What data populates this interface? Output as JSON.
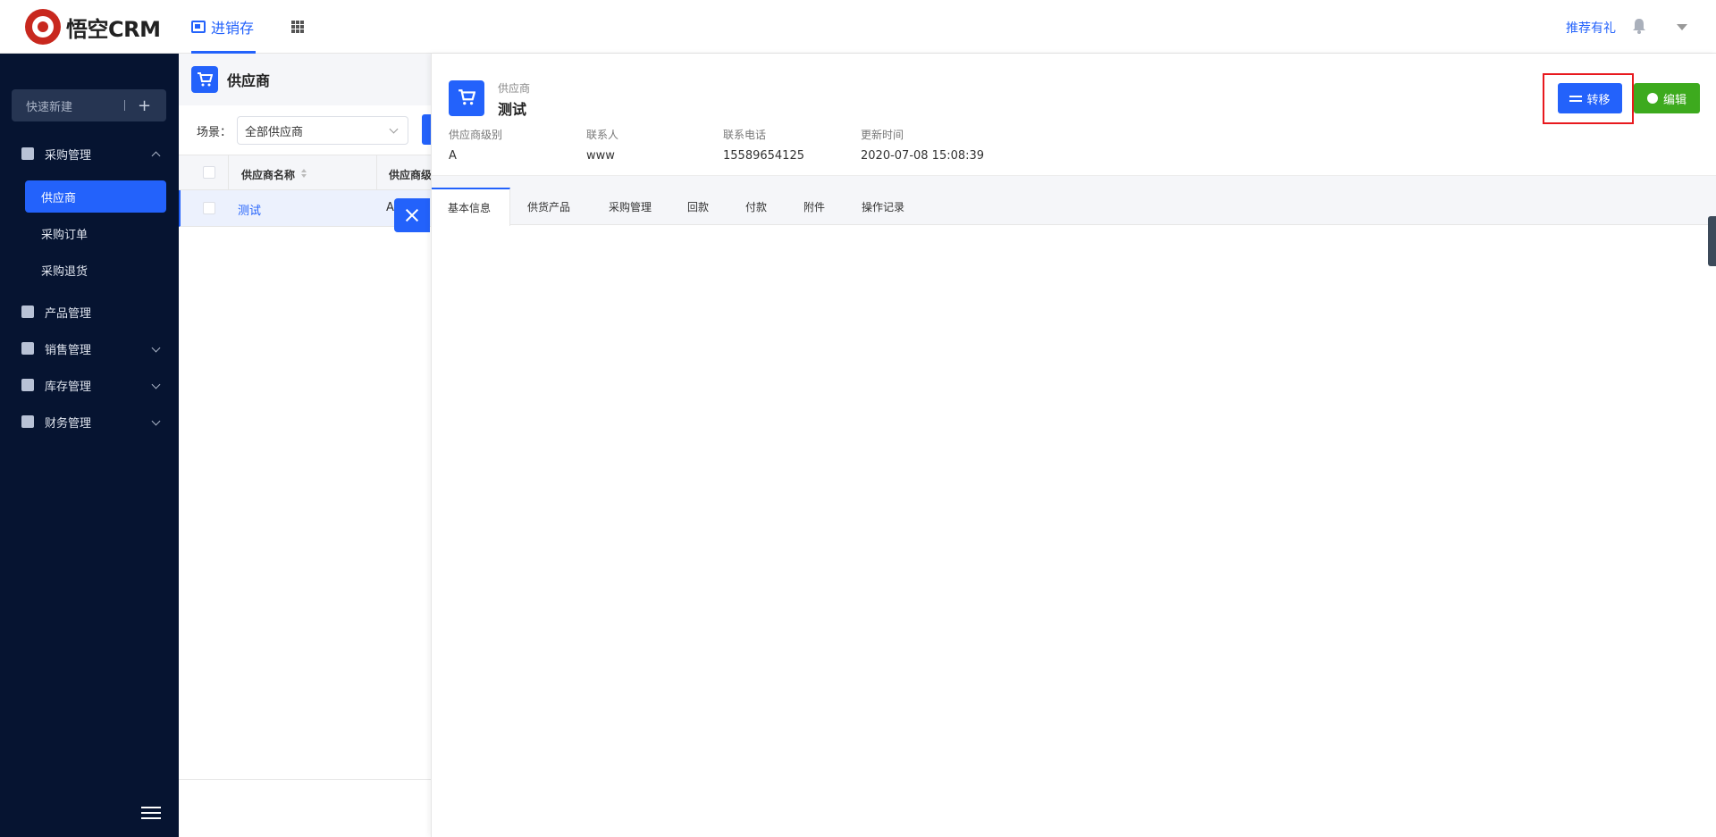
{
  "topbar": {
    "brand": "悟空CRM",
    "nav_tab": "进销存",
    "recommend": "推荐有礼"
  },
  "sidebar": {
    "quick_new": "快速新建",
    "groups": [
      {
        "label": "采购管理",
        "expanded": true
      },
      {
        "label": "产品管理",
        "expanded": false
      },
      {
        "label": "销售管理",
        "expanded": false
      },
      {
        "label": "库存管理",
        "expanded": false
      },
      {
        "label": "财务管理",
        "expanded": false
      }
    ],
    "sub_items": [
      {
        "label": "供应商",
        "active": true
      },
      {
        "label": "采购订单",
        "active": false
      },
      {
        "label": "采购退货",
        "active": false
      }
    ]
  },
  "list": {
    "title": "供应商",
    "scene_label": "场景：",
    "scene_value": "全部供应商",
    "columns": [
      "供应商名称",
      "供应商级别"
    ],
    "rows": [
      {
        "name": "测试",
        "level": "A"
      }
    ]
  },
  "detail": {
    "type": "供应商",
    "name": "测试",
    "fields": [
      {
        "label": "供应商级别",
        "value": "A"
      },
      {
        "label": "联系人",
        "value": "www"
      },
      {
        "label": "联系电话",
        "value": "15589654125"
      },
      {
        "label": "更新时间",
        "value": "2020-07-08 15:08:39"
      }
    ],
    "transfer_label": "转移",
    "edit_label": "编辑",
    "tabs": [
      "基本信息",
      "供货产品",
      "采购管理",
      "回款",
      "付款",
      "附件",
      "操作记录"
    ],
    "active_tab": "基本信息"
  },
  "colors": {
    "primary": "#2362fb",
    "success": "#3daa1e",
    "sidebar_bg": "#061431",
    "highlight": "#e8191e"
  }
}
